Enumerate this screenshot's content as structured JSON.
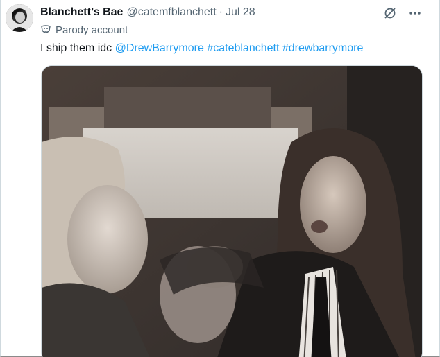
{
  "tweet": {
    "display_name": "Blanchett’s Bae",
    "handle": "@catemfblanchett",
    "separator": "·",
    "date": "Jul 28",
    "label": "Parody account",
    "text_plain": "I ship them idc",
    "mentions": [
      "@DrewBarrymore",
      "#cateblanchett",
      "#drewbarrymore"
    ]
  },
  "icons": {
    "avatar": "avatar",
    "grok": "grok-icon",
    "more": "more-icon",
    "parody": "parody-mask-icon"
  },
  "colors": {
    "link": "#1d9bf0",
    "secondary_text": "#536471",
    "primary_text": "#0f1419"
  }
}
